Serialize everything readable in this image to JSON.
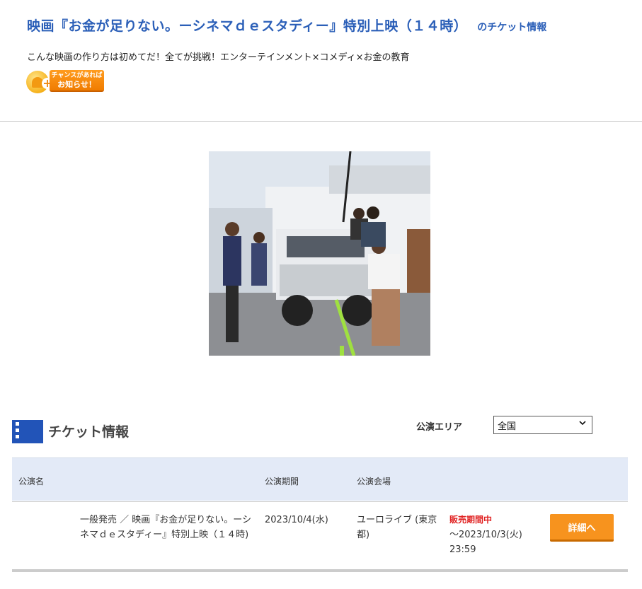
{
  "header": {
    "title": "映画『お金が足りない。ーシネマｄｅスタディー』特別上映（１４時）",
    "title_suffix": "のチケット情報",
    "subtitle": "こんな映画の作り方は初めてだ！全てが挑戦！エンターテインメント×コメディ×お金の教育",
    "notify_small": "チャンスがあれば",
    "notify_big": "お知らせ！"
  },
  "section": {
    "title": "チケット情報",
    "area_label": "公演エリア",
    "area_selected": "全国"
  },
  "table": {
    "headers": {
      "name": "公演名",
      "period": "公演期間",
      "venue": "公演会場"
    },
    "rows": [
      {
        "name": "一般発売 ／ 映画『お金が足りない。ーシネマｄｅスタディー』特別上映（１４時)",
        "period": "2023/10/4(水)",
        "venue": "ユーロライブ (東京都)",
        "status": "販売期間中",
        "deadline": "～2023/10/3(火) 23:59",
        "button": "詳細へ"
      }
    ]
  },
  "colors": {
    "accent_blue": "#2b5fb8",
    "button_orange": "#f7931e",
    "status_red": "#e02020"
  }
}
